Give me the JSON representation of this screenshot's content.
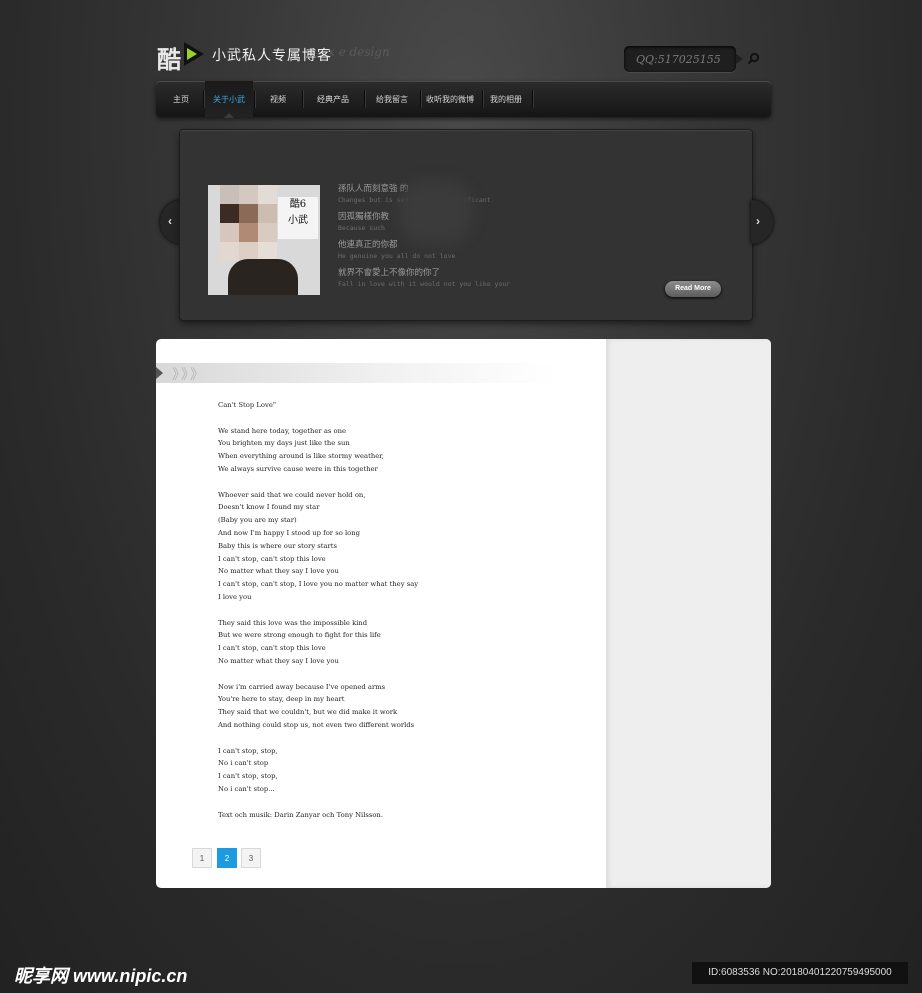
{
  "header": {
    "logo_glyph": "酷",
    "site_name": "小武私人专属博客",
    "tagline": "x                    e design",
    "qq": "QQ:517025155"
  },
  "nav": {
    "items": [
      {
        "label": "主页",
        "active": false
      },
      {
        "label": "关于小武",
        "active": true
      },
      {
        "label": "视频",
        "active": false
      },
      {
        "label": "经典产品",
        "active": false
      },
      {
        "label": "给我留言",
        "active": false
      },
      {
        "label": "收听我的微博",
        "active": false
      },
      {
        "label": "我的相册",
        "active": false
      }
    ]
  },
  "slider": {
    "photo_sign": "酷6\n小武",
    "lines": [
      {
        "text": "孫队人而刻意強      的",
        "lang": "cn"
      },
      {
        "text": "Changes but          is sedulously insignificant",
        "lang": "en"
      },
      {
        "text": "因孤獨樣你教",
        "lang": "cn"
      },
      {
        "text": "Because such",
        "lang": "en"
      },
      {
        "text": "他連真正的你都",
        "lang": "cn"
      },
      {
        "text": "He genuine you all do not love",
        "lang": "en"
      },
      {
        "text": "就界不會愛上不像你的你了",
        "lang": "cn"
      },
      {
        "text": "Fall in love with it would not you like your",
        "lang": "en"
      }
    ],
    "read_more": "Read More",
    "prev_glyph": "‹",
    "next_glyph": "›"
  },
  "content": {
    "ribbon_glyph": "》》》",
    "lyrics": [
      "Can't Stop Love\"",
      "",
      "We stand here today, together as one",
      "You brighten my days just like the sun",
      "When everything around is like stormy weather,",
      "We always survive cause were in this together",
      "",
      "Whoever said that we could never hold on,",
      "Doesn't know I found my star",
      "(Baby you are my star)",
      "And now I'm happy I stood up for so long",
      "Baby this is where our story starts",
      "I can't stop, can't stop this love",
      "No matter what they say I love you",
      "I can't stop, can't stop, I love you no matter what they say",
      "I love you",
      "",
      "They said this love was the impossible kind",
      "But we were strong enough to fight for this life",
      "I can't stop, can't stop this love",
      "No matter what they say I love you",
      "",
      "Now i'm carried away because I've opened arms",
      "You're here to stay, deep in my heart",
      "They said that we couldn't, but we did make it work",
      "And nothing could stop us, not even two different worlds",
      "",
      "I can't stop, stop,",
      "No i can't stop",
      "I can't stop, stop,",
      "No i can't stop...",
      "",
      "Text och musik: Darin Zanyar och Tony Nilsson."
    ],
    "pages": [
      "1",
      "2",
      "3"
    ],
    "current_page": "2"
  },
  "watermark": {
    "left": "昵享网 www.nipic.cn",
    "right": "ID:6083536 NO:20180401220759495000"
  },
  "colors": {
    "accent": "#3ea7e8",
    "page_active": "#1e9be0",
    "logo_green": "#9ad12b"
  }
}
